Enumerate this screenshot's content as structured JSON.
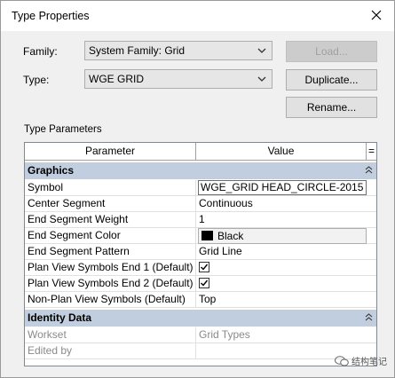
{
  "window": {
    "title": "Type Properties"
  },
  "family": {
    "label": "Family:",
    "value": "System Family: Grid",
    "load_label": "Load..."
  },
  "type": {
    "label": "Type:",
    "value": "WGE GRID",
    "duplicate_label": "Duplicate..."
  },
  "rename_label": "Rename...",
  "type_parameters_label": "Type Parameters",
  "table": {
    "col_parameter": "Parameter",
    "col_value": "Value",
    "col_sort": "=",
    "groups": [
      {
        "name": "Graphics"
      },
      {
        "name": "Identity Data"
      }
    ],
    "graphics_rows": [
      {
        "param": "Symbol",
        "value": "WGE_GRID HEAD_CIRCLE-2015 :"
      },
      {
        "param": "Center Segment",
        "value": "Continuous"
      },
      {
        "param": "End Segment Weight",
        "value": "1"
      },
      {
        "param": "End Segment Color",
        "value": "Black"
      },
      {
        "param": "End Segment Pattern",
        "value": "Grid Line"
      },
      {
        "param": "Plan View Symbols End 1 (Default)",
        "checked": true
      },
      {
        "param": "Plan View Symbols End 2 (Default)",
        "checked": true
      },
      {
        "param": "Non-Plan View Symbols (Default)",
        "value": "Top"
      }
    ],
    "identity_rows": [
      {
        "param": "Workset",
        "value": "Grid Types"
      },
      {
        "param": "Edited by",
        "value": ""
      }
    ]
  },
  "watermark": "结构笔记",
  "colors": {
    "group_bg": "#c1cedf",
    "swatch": "#000000"
  }
}
